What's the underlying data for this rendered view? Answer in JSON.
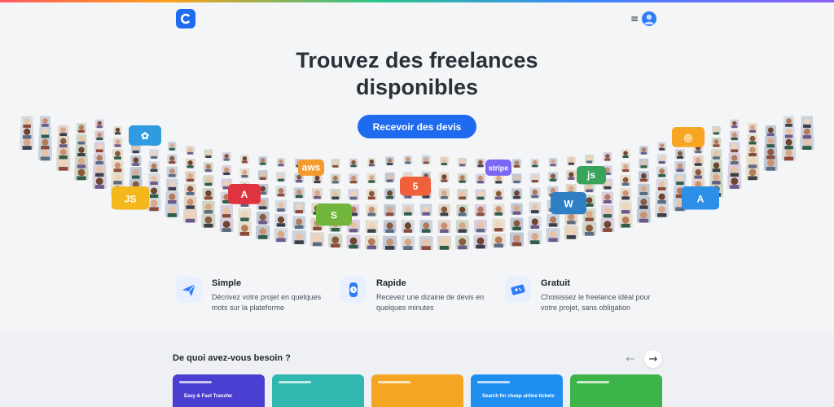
{
  "header": {
    "logo_icon": "brand-c-icon",
    "menu_icon": "hamburger-icon",
    "menu_glyph": "≡",
    "avatar_icon": "user-avatar-icon"
  },
  "hero": {
    "title_line1": "Trouvez des freelances",
    "title_line2": "disponibles",
    "cta_label": "Recevoir des devis"
  },
  "mosaic": {
    "tiles": [
      {
        "label": "JS",
        "color": "#f5b81c",
        "icon": "javascript-icon"
      },
      {
        "label": "A",
        "color": "#e03340",
        "icon": "angular-icon"
      },
      {
        "label": "aws",
        "color": "#f39b2c",
        "icon": "aws-icon"
      },
      {
        "label": "S",
        "color": "#71b53b",
        "icon": "shopify-icon"
      },
      {
        "label": "5",
        "color": "#f0603a",
        "icon": "html5-icon"
      },
      {
        "label": "stripe",
        "color": "#7a68f5",
        "icon": "stripe-icon"
      },
      {
        "label": "W",
        "color": "#2f7fc4",
        "icon": "wordpress-icon"
      },
      {
        "label": "js",
        "color": "#3aa35a",
        "icon": "nodejs-icon"
      },
      {
        "label": "A",
        "color": "#2d8fe8",
        "icon": "app-store-icon"
      },
      {
        "label": "✿",
        "color": "#2f9be0",
        "icon": "clover-icon"
      },
      {
        "label": "◎",
        "color": "#f6a623",
        "icon": "chrome-icon"
      }
    ]
  },
  "features": [
    {
      "title": "Simple",
      "desc": "Décrivez votre projet en quelques mots sur la plateforme",
      "icon": "paper-plane-icon"
    },
    {
      "title": "Rapide",
      "desc": "Recevez une dizaine de devis en quelques minutes",
      "icon": "stopwatch-icon"
    },
    {
      "title": "Gratuit",
      "desc": "Choisissez le freelance idéal pour votre projet, sans obligation",
      "icon": "ticket-icon"
    }
  ],
  "categories": {
    "title": "De quoi avez-vous besoin ?",
    "prev_glyph": "←",
    "next_glyph": "→",
    "cards": [
      {
        "color": "#4b3fd1",
        "caption": "Easy & Fast Transfer"
      },
      {
        "color": "#2fb7b0",
        "caption": ""
      },
      {
        "color": "#f4a623",
        "caption": ""
      },
      {
        "color": "#1f8ef1",
        "caption": "Search for cheap airline tickets"
      },
      {
        "color": "#3cb44a",
        "caption": ""
      }
    ]
  },
  "colors": {
    "accent": "#1e6bf0",
    "background": "#f4f5f7",
    "lower_background": "#eef0f3"
  }
}
